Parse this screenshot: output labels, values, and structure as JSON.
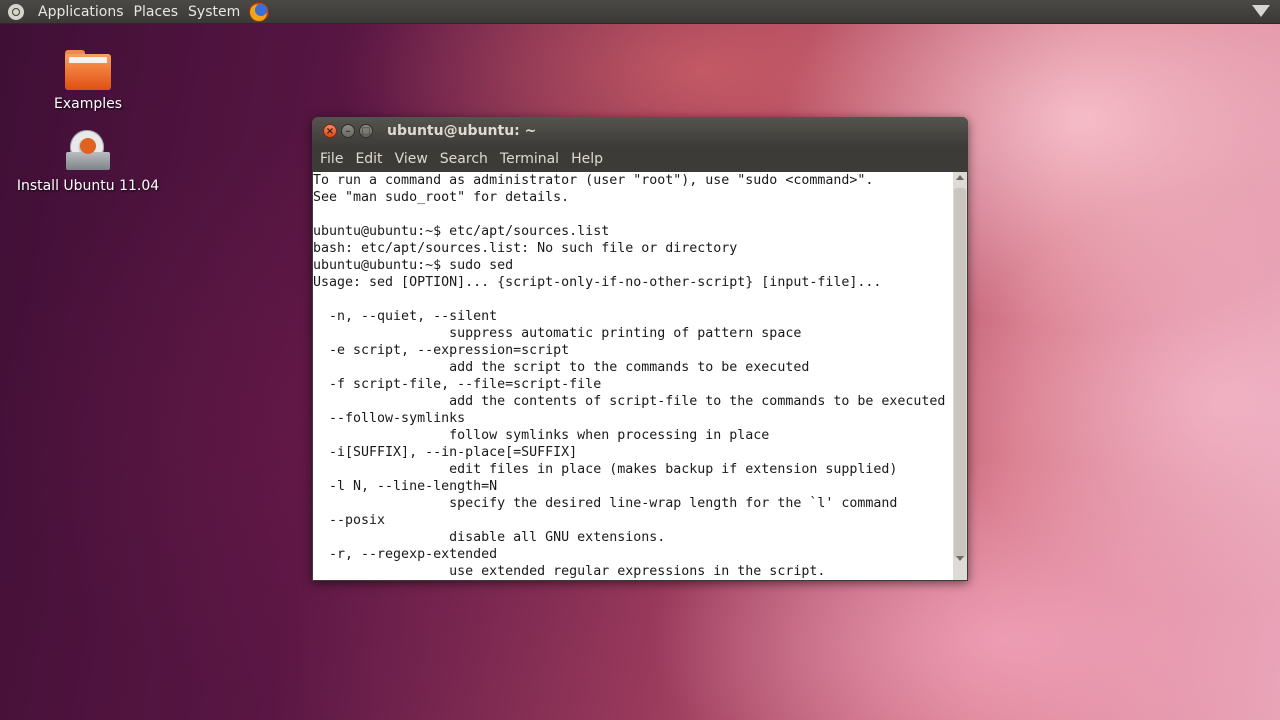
{
  "top_panel": {
    "menus": [
      "Applications",
      "Places",
      "System"
    ],
    "icons": [
      "ubuntu-logo-icon",
      "firefox-icon",
      "network-icon"
    ]
  },
  "desktop": {
    "icons": [
      {
        "label": "Examples",
        "icon": "folder-icon"
      },
      {
        "label": "Install Ubuntu 11.04",
        "icon": "installer-icon"
      }
    ]
  },
  "terminal": {
    "title": "ubuntu@ubuntu: ~",
    "menu": [
      "File",
      "Edit",
      "View",
      "Search",
      "Terminal",
      "Help"
    ],
    "lines": [
      "To run a command as administrator (user \"root\"), use \"sudo <command>\".",
      "See \"man sudo_root\" for details.",
      "",
      "ubuntu@ubuntu:~$ etc/apt/sources.list",
      "bash: etc/apt/sources.list: No such file or directory",
      "ubuntu@ubuntu:~$ sudo sed",
      "Usage: sed [OPTION]... {script-only-if-no-other-script} [input-file]...",
      "",
      "  -n, --quiet, --silent",
      "                 suppress automatic printing of pattern space",
      "  -e script, --expression=script",
      "                 add the script to the commands to be executed",
      "  -f script-file, --file=script-file",
      "                 add the contents of script-file to the commands to be executed",
      "  --follow-symlinks",
      "                 follow symlinks when processing in place",
      "  -i[SUFFIX], --in-place[=SUFFIX]",
      "                 edit files in place (makes backup if extension supplied)",
      "  -l N, --line-length=N",
      "                 specify the desired line-wrap length for the `l' command",
      "  --posix",
      "                 disable all GNU extensions.",
      "  -r, --regexp-extended",
      "                 use extended regular expressions in the script."
    ]
  },
  "colors": {
    "panel": "#3c3b37",
    "close_button": "#dd4814",
    "terminal_bg": "#ffffff",
    "terminal_fg": "#1a1a1a"
  }
}
